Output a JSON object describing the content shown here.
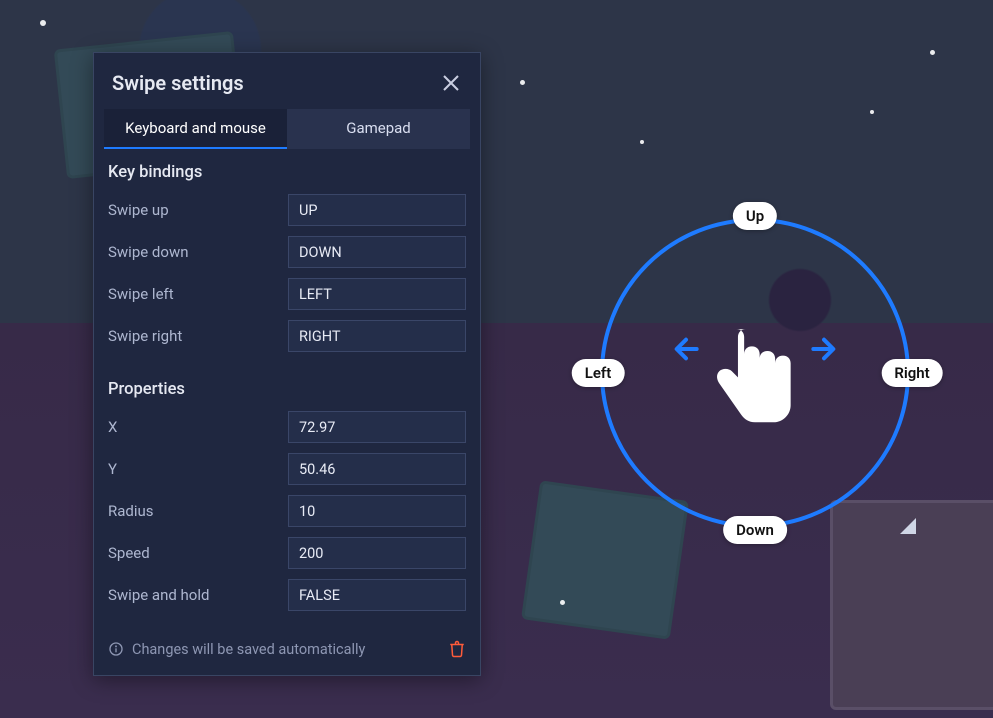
{
  "panel": {
    "title": "Swipe settings",
    "tabs": {
      "keyboard": "Keyboard and mouse",
      "gamepad": "Gamepad"
    },
    "keyBindings": {
      "heading": "Key bindings",
      "swipeUp": {
        "label": "Swipe up",
        "value": "UP"
      },
      "swipeDown": {
        "label": "Swipe down",
        "value": "DOWN"
      },
      "swipeLeft": {
        "label": "Swipe left",
        "value": "LEFT"
      },
      "swipeRight": {
        "label": "Swipe right",
        "value": "RIGHT"
      }
    },
    "properties": {
      "heading": "Properties",
      "x": {
        "label": "X",
        "value": "72.97"
      },
      "y": {
        "label": "Y",
        "value": "50.46"
      },
      "radius": {
        "label": "Radius",
        "value": "10"
      },
      "speed": {
        "label": "Speed",
        "value": "200"
      },
      "hold": {
        "label": "Swipe and hold",
        "value": "FALSE"
      }
    },
    "footer": {
      "autosave": "Changes will be saved automatically"
    }
  },
  "overlay": {
    "up": "Up",
    "down": "Down",
    "left": "Left",
    "right": "Right"
  },
  "colors": {
    "accent": "#1e7bff",
    "danger": "#ff5b3a"
  }
}
